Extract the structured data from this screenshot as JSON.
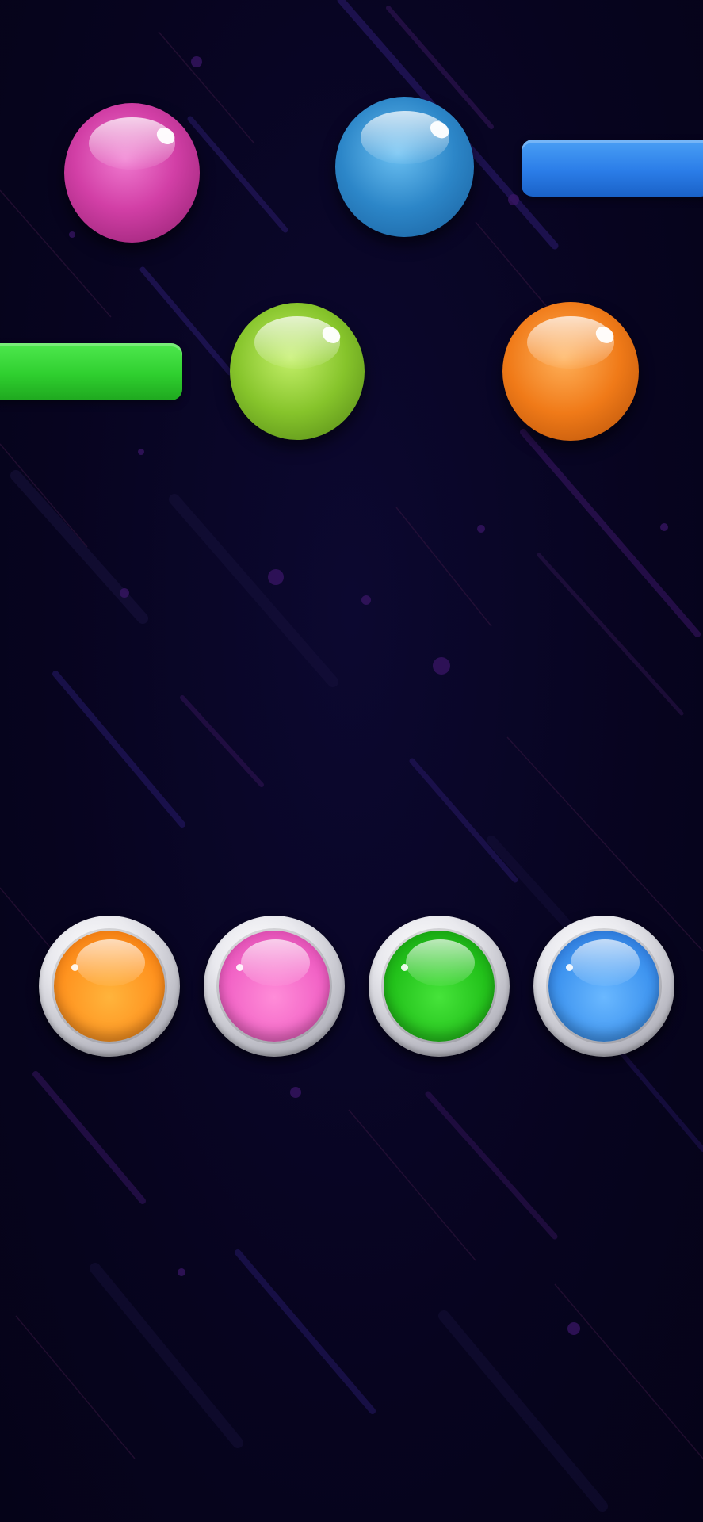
{
  "game": {
    "background_color": "#07041f",
    "balls": [
      {
        "color_name": "pink",
        "color": "#d23fa6"
      },
      {
        "color_name": "blue",
        "color": "#2c86c8"
      },
      {
        "color_name": "green",
        "color": "#86c42b"
      },
      {
        "color_name": "orange",
        "color": "#f07a18"
      }
    ],
    "bars": [
      {
        "color_name": "blue",
        "color": "#2b7de8"
      },
      {
        "color_name": "green",
        "color": "#2fcf2f"
      }
    ],
    "color_buttons": [
      {
        "color_name": "orange",
        "color": "#ff9420"
      },
      {
        "color_name": "pink",
        "color": "#f264c6"
      },
      {
        "color_name": "green",
        "color": "#23c21b"
      },
      {
        "color_name": "blue",
        "color": "#3f95f0"
      }
    ]
  }
}
